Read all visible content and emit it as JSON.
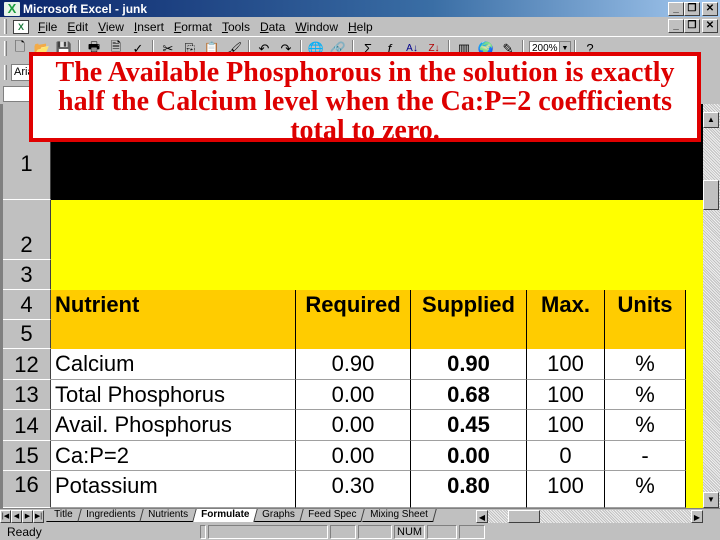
{
  "window": {
    "title": "Microsoft Excel - junk",
    "app_icon": "excel-icon"
  },
  "menu": {
    "items": [
      "File",
      "Edit",
      "View",
      "Insert",
      "Format",
      "Tools",
      "Data",
      "Window",
      "Help"
    ]
  },
  "toolbar": {
    "icons": [
      "new-icon",
      "open-icon",
      "save-icon",
      "print-icon",
      "print-preview-icon",
      "spelling-icon",
      "cut-icon",
      "copy-icon",
      "paste-icon",
      "format-painter-icon",
      "undo-icon",
      "redo-icon",
      "web-toolbar-icon",
      "hyperlink-icon",
      "autosum-icon",
      "function-icon",
      "sort-ascending-icon",
      "sort-descending-icon",
      "chart-wizard-icon",
      "map-icon",
      "drawing-icon",
      "help-icon"
    ],
    "glyphs": [
      "🗋",
      "📂",
      "💾",
      "🖶",
      "🗎",
      "✓",
      "✂",
      "⎘",
      "📋",
      "🖌",
      "↶",
      "↷",
      "🌐",
      "🔗",
      "Σ",
      "ƒ",
      "A↓",
      "Z↓",
      "▥",
      "🌍",
      "✎",
      "?"
    ],
    "zoom": "200%"
  },
  "formatbar": {
    "font": "Arial"
  },
  "callout": {
    "text": "The Available Phosphorous in the solution is exactly half the Calcium level when the Ca:P=2 coefficients total to zero.",
    "color": "#dd0000"
  },
  "sheet": {
    "rows": [
      {
        "num": "1",
        "style": "black"
      },
      {
        "num": "2",
        "style": "yellow"
      },
      {
        "num": "3",
        "style": "yellow"
      },
      {
        "num": "4",
        "style": "header",
        "cells": [
          "Nutrient",
          "Required",
          "Supplied",
          "Max.",
          "Units"
        ]
      },
      {
        "num": "5",
        "style": "header-blank"
      },
      {
        "num": "12",
        "nutrient": "Calcium",
        "required": "0.90",
        "supplied": "0.90",
        "max": "100",
        "units": "%"
      },
      {
        "num": "13",
        "nutrient": "Total Phosphorus",
        "required": "0.00",
        "supplied": "0.68",
        "max": "100",
        "units": "%"
      },
      {
        "num": "14",
        "nutrient": "Avail. Phosphorus",
        "required": "0.00",
        "supplied": "0.45",
        "max": "100",
        "units": "%"
      },
      {
        "num": "15",
        "nutrient": "Ca:P=2",
        "required": "0.00",
        "supplied": "0.00",
        "max": "0",
        "units": "-"
      },
      {
        "num": "16",
        "nutrient": "Potassium",
        "required": "0.30",
        "supplied": "0.80",
        "max": "100",
        "units": "%"
      }
    ],
    "colors": {
      "title_band": "#000000",
      "yellow": "#ffff00",
      "header": "#ffcc00"
    }
  },
  "tabs": {
    "items": [
      "Title",
      "Ingredients",
      "Nutrients",
      "Formulate",
      "Graphs",
      "Feed Spec",
      "Mixing Sheet"
    ],
    "active": "Formulate"
  },
  "status": {
    "text": "Ready",
    "num": "NUM"
  }
}
